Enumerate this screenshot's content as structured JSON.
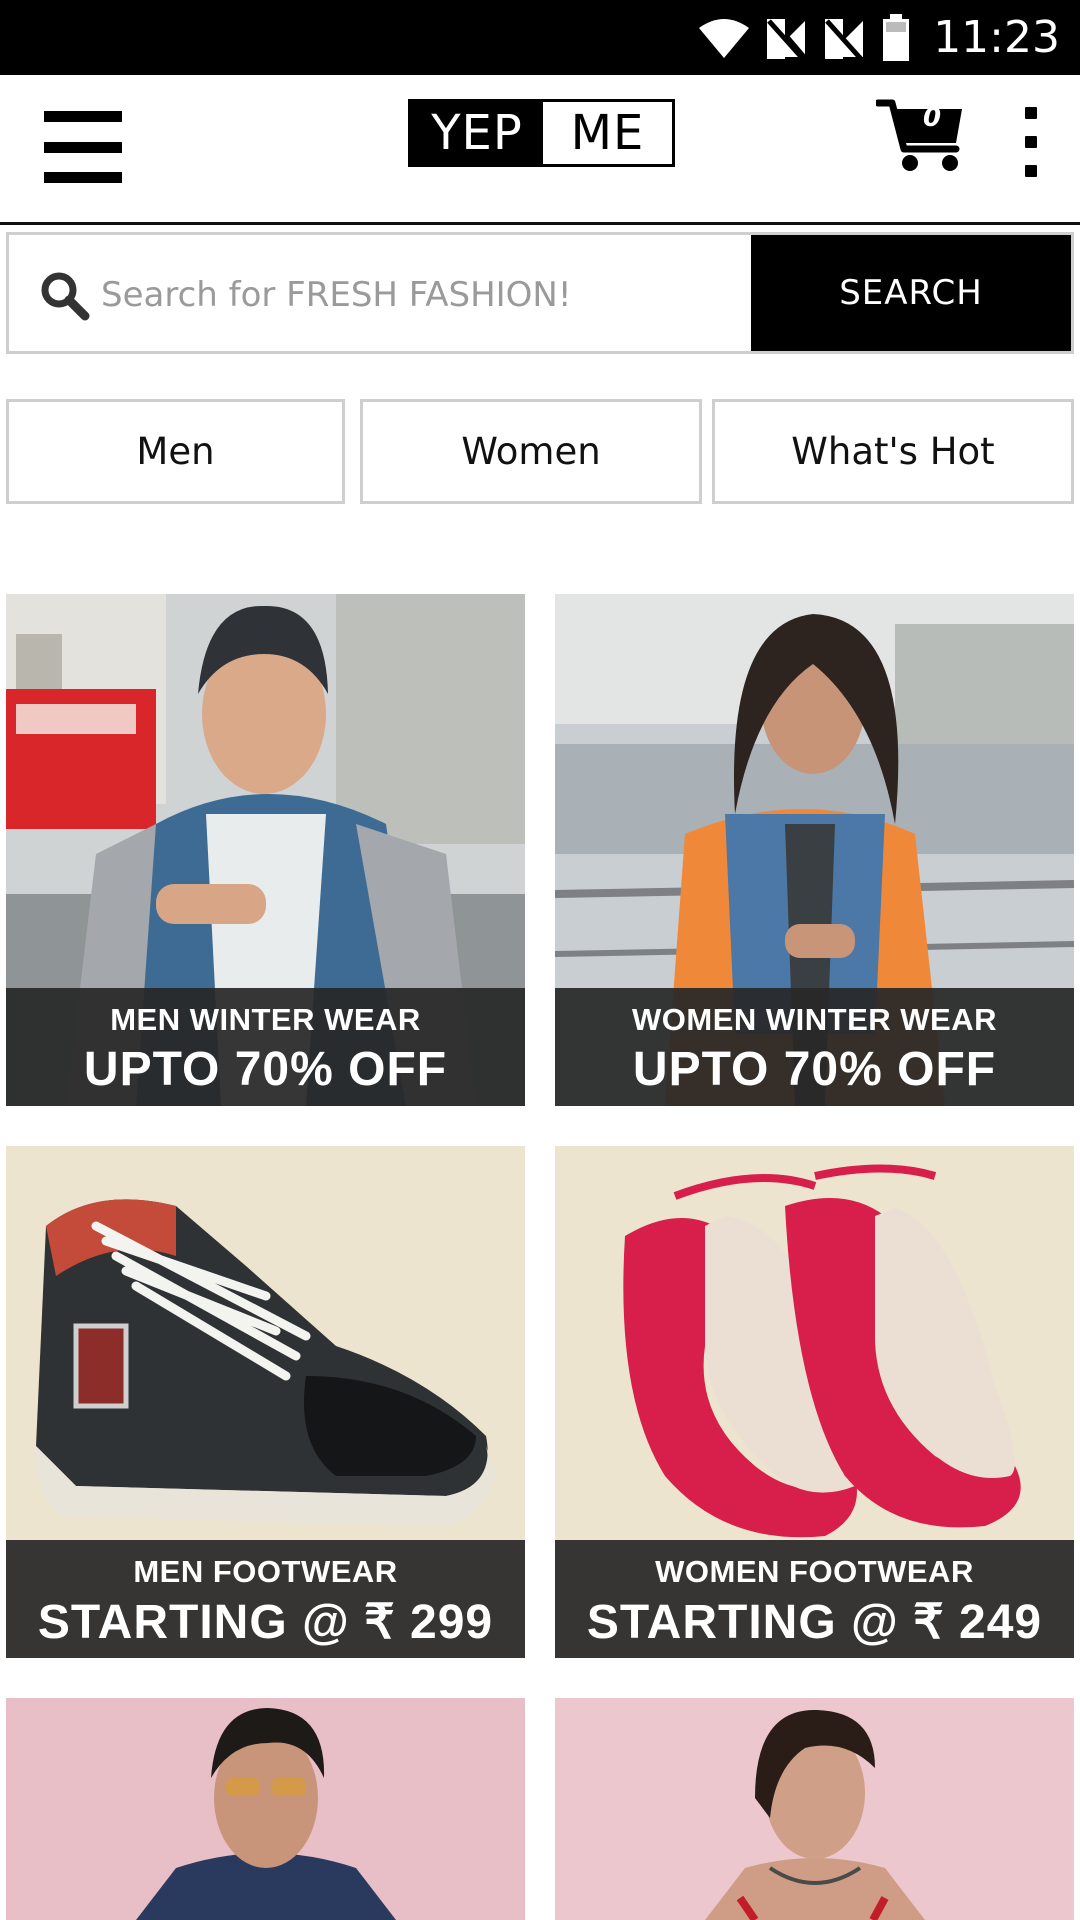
{
  "status_bar": {
    "time": "11:23",
    "icons": [
      "wifi-icon",
      "signal-off-icon",
      "signal-off-icon",
      "battery-icon"
    ]
  },
  "app_bar": {
    "menu_icon": "hamburger-menu-icon",
    "logo_left": "YEP",
    "logo_right": "ME",
    "cart_count": "0",
    "cart_icon": "shopping-cart-icon",
    "overflow_icon": "more-vert-icon"
  },
  "search": {
    "placeholder": "Search for FRESH FASHION!",
    "value": "",
    "button_label": "SEARCH",
    "icon": "search-icon"
  },
  "tabs": [
    {
      "label": "Men"
    },
    {
      "label": "Women"
    },
    {
      "label": "What's Hot"
    }
  ],
  "banners": [
    {
      "line1": "MEN WINTER WEAR",
      "line2": "UPTO 70% OFF"
    },
    {
      "line1": "WOMEN WINTER WEAR",
      "line2": "UPTO 70% OFF"
    },
    {
      "line1": "MEN FOOTWEAR",
      "line2": "STARTING @ ₹ 299"
    },
    {
      "line1": "WOMEN FOOTWEAR",
      "line2": "STARTING @ ₹ 249"
    }
  ],
  "colors": {
    "status_bar": "#000000",
    "accent": "#000000",
    "caption_bg": "#282828",
    "footwear_bg": "#ede4d0",
    "portrait_bg": "#e8bfc6"
  }
}
